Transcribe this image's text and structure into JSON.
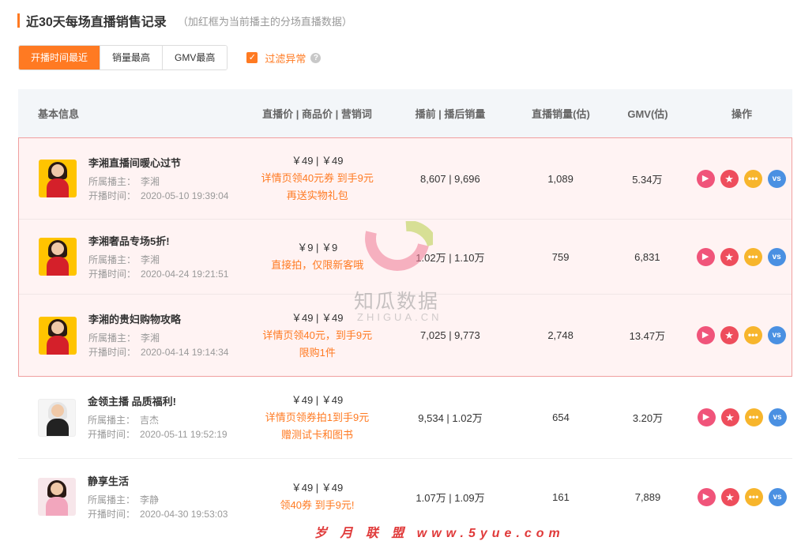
{
  "header": {
    "title": "近30天每场直播销售记录",
    "subtitle": "（加红框为当前播主的分场直播数据）"
  },
  "sort_tabs": [
    {
      "label": "开播时间最近",
      "active": true
    },
    {
      "label": "销量最高",
      "active": false
    },
    {
      "label": "GMV最高",
      "active": false
    }
  ],
  "filter": {
    "label": "过滤异常",
    "checked": true,
    "help_icon": "question-circle-icon"
  },
  "table": {
    "headers": {
      "info": "基本信息",
      "price": "直播价 | 商品价 | 营销词",
      "sales": "播前 | 播后销量",
      "est": "直播销量(估)",
      "gmv": "GMV(估)",
      "op": "操作"
    },
    "owner_label": "所属播主：",
    "time_label": "开播时间：",
    "rows": [
      {
        "title": "李湘直播间暖心过节",
        "owner": "李湘",
        "time": "2020-05-10 19:39:04",
        "price": "￥49 | ￥49",
        "promo1": "详情页领40元券 到手9元",
        "promo2": "再送实物礼包",
        "sales": "8,607 | 9,696",
        "est": "1,089",
        "gmv": "5.34万",
        "highlight": true
      },
      {
        "title": "李湘奢品专场5折!",
        "owner": "李湘",
        "time": "2020-04-24 19:21:51",
        "price": "￥9 | ￥9",
        "promo1": "直接拍，仅限新客哦",
        "promo2": "",
        "sales": "1.02万 | 1.10万",
        "est": "759",
        "gmv": "6,831",
        "highlight": true
      },
      {
        "title": "李湘的贵妇购物攻略",
        "owner": "李湘",
        "time": "2020-04-14 19:14:34",
        "price": "￥49 | ￥49",
        "promo1": "详情页领40元，到手9元",
        "promo2": "限购1件",
        "sales": "7,025 | 9,773",
        "est": "2,748",
        "gmv": "13.47万",
        "highlight": true
      },
      {
        "title": "金领主播 品质福利!",
        "owner": "吉杰",
        "time": "2020-05-11 19:52:19",
        "price": "￥49 | ￥49",
        "promo1": "详情页领券拍1到手9元",
        "promo2": "赠测试卡和图书",
        "sales": "9,534 | 1.02万",
        "est": "654",
        "gmv": "3.20万",
        "highlight": false
      },
      {
        "title": "静享生活",
        "owner": "李静",
        "time": "2020-04-30 19:53:03",
        "price": "￥49 | ￥49",
        "promo1": "领40券 到手9元!",
        "promo2": "",
        "sales": "1.07万 | 1.09万",
        "est": "161",
        "gmv": "7,889",
        "highlight": false
      }
    ],
    "ops": {
      "play": "▶",
      "star": "★",
      "more": "•••",
      "vs": "vs"
    }
  },
  "watermark": {
    "cn": "知瓜数据",
    "en": "ZHIGUA.CN",
    "footer": "岁 月 联 盟  www.5yue.com"
  },
  "colors": {
    "accent": "#ff7a22",
    "highlight_border": "#f0a0a0",
    "highlight_bg": "#fff3f3"
  }
}
